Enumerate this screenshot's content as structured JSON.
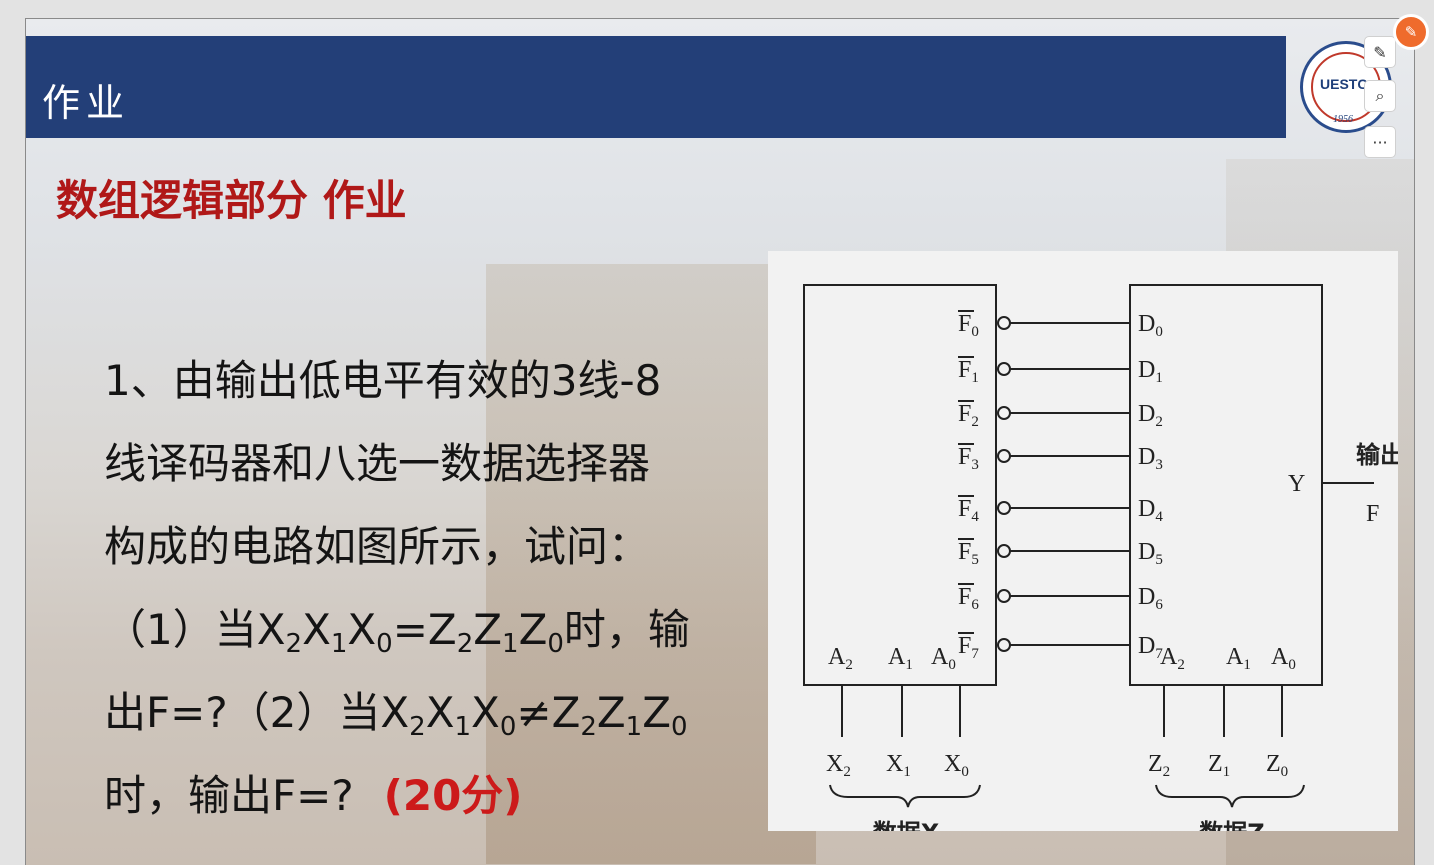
{
  "slide": {
    "title": "作业",
    "subtitle": "数组逻辑部分 作业",
    "logo": {
      "text": "UESTC",
      "year": "1956"
    }
  },
  "question": {
    "line1": "1、由输出低电平有效的3线-8",
    "line2": "线译码器和八选一数据选择器",
    "line3": "构成的电路如图所示，试问：",
    "line4": {
      "prefix": "（1）当",
      "x2": "X",
      "s2": "2",
      "x1": "X",
      "s1": "1",
      "x0": "X",
      "s0": "0",
      "eq": "=",
      "z2": "Z",
      "t2": "2",
      "z1": "Z",
      "t1": "1",
      "z0": "Z",
      "t0": "0",
      "suffix": "时，输"
    },
    "line5": {
      "prefix": "出F=?（2）当",
      "x2": "X",
      "s2": "2",
      "x1": "X",
      "s1": "1",
      "x0": "X",
      "s0": "0",
      "neq": "≠",
      "z2": "Z",
      "t2": "2",
      "z1": "Z",
      "t1": "1",
      "z0": "Z",
      "t0": "0"
    },
    "line6": {
      "text": "时，输出F=?",
      "score": "(20分)"
    }
  },
  "figure": {
    "decoder_outputs": [
      "F",
      "F",
      "F",
      "F",
      "F",
      "F",
      "F",
      "F"
    ],
    "output_subs": [
      "0",
      "1",
      "2",
      "3",
      "4",
      "5",
      "6",
      "7"
    ],
    "mux_inputs": [
      "D",
      "D",
      "D",
      "D",
      "D",
      "D",
      "D",
      "D"
    ],
    "decoder_addr": [
      "A",
      "A",
      "A"
    ],
    "addr_subs": [
      "2",
      "1",
      "0"
    ],
    "mux_addr": [
      "A",
      "A",
      "A"
    ],
    "x_inputs": [
      "X",
      "X",
      "X"
    ],
    "z_inputs": [
      "Z",
      "Z",
      "Z"
    ],
    "y_label": "Y",
    "output_label": "输出",
    "f_label": "F",
    "x_group": "数据X",
    "z_group": "数据Z"
  },
  "tools": {
    "edit": "✎",
    "search": "⌕",
    "more": "···",
    "badge": "✎"
  }
}
